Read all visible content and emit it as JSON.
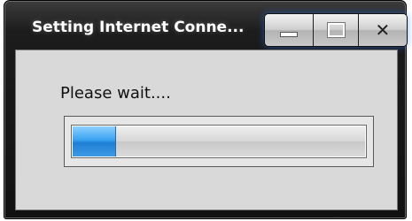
{
  "window": {
    "title": "Setting Internet Conne...",
    "controls": {
      "minimize_icon": "minimize-icon",
      "maximize_icon": "maximize-icon",
      "close_icon": "close-icon",
      "close_glyph": "✕"
    }
  },
  "dialog": {
    "message": "Please wait....",
    "progress": {
      "fraction": 0.15,
      "fill_color": "#2f8fe3"
    }
  }
}
